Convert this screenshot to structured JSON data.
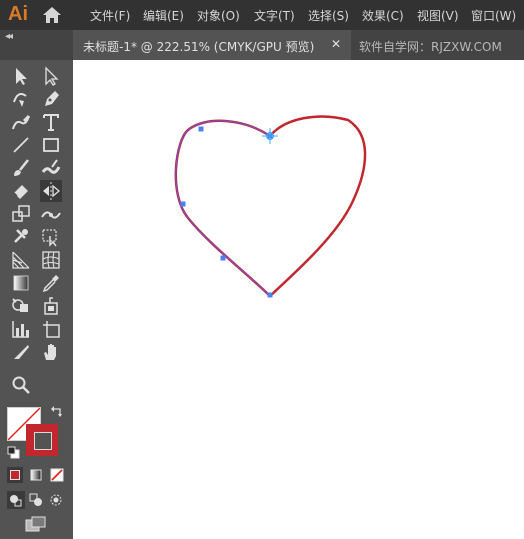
{
  "app": {
    "logo": "Ai",
    "brand_color": "#d97a29"
  },
  "menu": {
    "items": [
      {
        "label": "文件(F)"
      },
      {
        "label": "编辑(E)"
      },
      {
        "label": "对象(O)"
      },
      {
        "label": "文字(T)"
      },
      {
        "label": "选择(S)"
      },
      {
        "label": "效果(C)"
      },
      {
        "label": "视图(V)"
      },
      {
        "label": "窗口(W)"
      }
    ]
  },
  "tabs": {
    "active": {
      "label": "未标题-1* @ 222.51% (CMYK/GPU 预览)",
      "close": "✕"
    },
    "inactive": {
      "label": "软件自学网：RJZXW.COM"
    }
  },
  "toolbar": {
    "collapse": "◂◂",
    "tools": [
      "selection-tool",
      "direct-selection-tool",
      "curvature-tool",
      "pen-tool",
      "pencil-tool",
      "type-tool",
      "line-tool",
      "rectangle-tool",
      "paintbrush-tool",
      "blob-brush-tool",
      "eraser-tool",
      "reflect-tool",
      "scale-tool",
      "width-tool",
      "puppet-warp-tool",
      "free-transform-tool",
      "perspective-grid-tool",
      "mesh-tool",
      "gradient-tool",
      "eyedropper-tool",
      "shape-builder-tool",
      "live-paint-tool",
      "graph-tool",
      "artboard-tool",
      "slice-tool",
      "hand-tool",
      "zoom-tool"
    ],
    "fill_color": "#ffffff",
    "stroke_color": "#c1272d"
  },
  "canvas": {
    "heart_stroke": "#c1272d",
    "selected_path_color": "#7b4fc8",
    "anchor_color": "#4f7ff0"
  }
}
